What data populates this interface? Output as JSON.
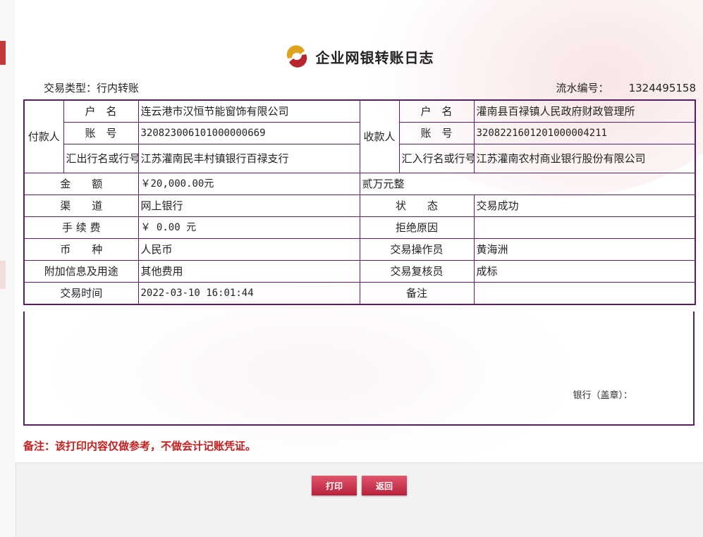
{
  "page": {
    "title": "企业网银转账日志"
  },
  "colors": {
    "border": "#5b1d63",
    "note": "#c41e1e",
    "button": "#c8324a"
  },
  "meta": {
    "type_label": "交易类型：行内转账",
    "serial_label": "流水编号：",
    "serial_value": "1324495158"
  },
  "payer": {
    "side_label": "付款人",
    "name_label": "户　名",
    "name": "连云港市汉恒节能窗饰有限公司",
    "account_label": "账　号",
    "account": "320823006101000000669",
    "bank_label": "汇出行名或行号",
    "bank": "江苏灌南民丰村镇银行百禄支行"
  },
  "payee": {
    "side_label": "收款人",
    "name_label": "户　名",
    "name": "灌南县百禄镇人民政府财政管理所",
    "account_label": "账　号",
    "account": "3208221601201000004211",
    "bank_label": "汇入行名或行号",
    "bank": "江苏灌南农村商业银行股份有限公司"
  },
  "details": {
    "amount_label": "金　　额",
    "amount": "￥20,000.00元",
    "amount_upper": "贰万元整",
    "channel_label": "渠　　道",
    "channel": "网上银行",
    "status_label": "状　　态",
    "status": "交易成功",
    "fee_label": "手 续 费",
    "fee": "￥ 0.00 元",
    "reject_label": "拒绝原因",
    "reject": "",
    "currency_label": "币　　种",
    "currency": "人民币",
    "operator_label": "交易操作员",
    "operator": "黄海洲",
    "purpose_label": "附加信息及用途",
    "purpose": "其他费用",
    "reviewer_label": "交易复核员",
    "reviewer": "成标",
    "time_label": "交易时间",
    "time": "2022-03-10 16:01:44",
    "remark_label": "备注",
    "remark": ""
  },
  "stamp_label": "银行（盖章）：",
  "note": "备注：该打印内容仅做参考，不做会计记账凭证。",
  "buttons": {
    "print": "打印",
    "back": "返回"
  }
}
